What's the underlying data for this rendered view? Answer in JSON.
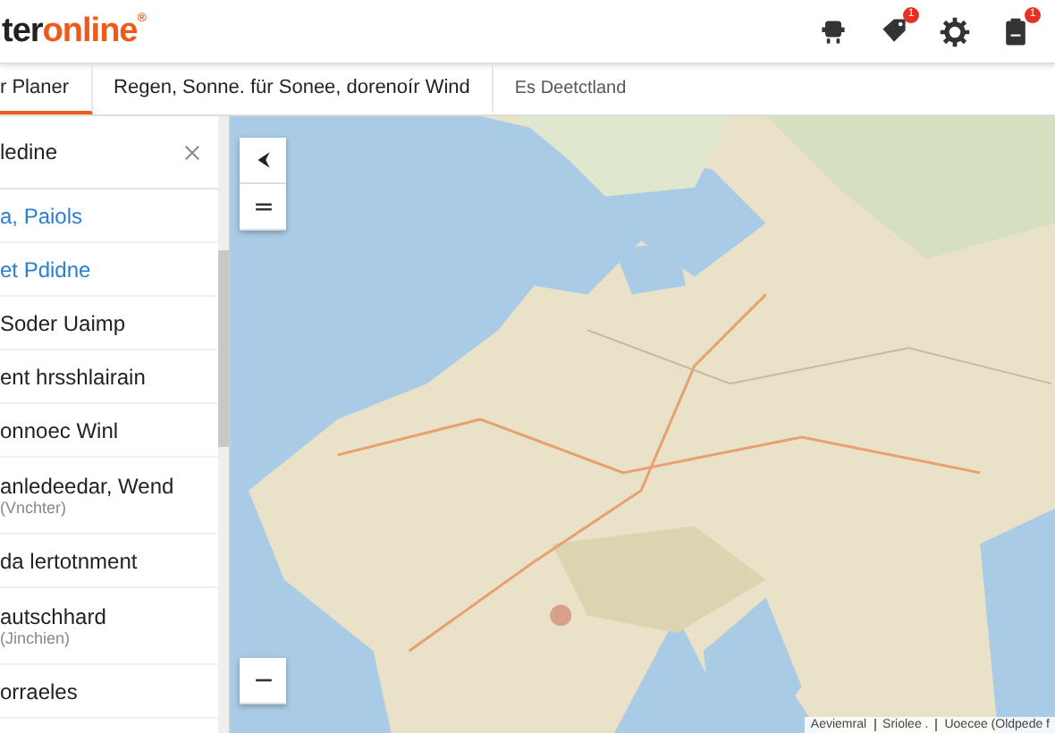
{
  "logo": {
    "dark": "ter",
    "accent": "online",
    "mark": "®"
  },
  "header_icons": [
    {
      "kind": "robot"
    },
    {
      "kind": "tag",
      "badge": "1"
    },
    {
      "kind": "gear"
    },
    {
      "kind": "clipboard",
      "badge": "1"
    }
  ],
  "nav": [
    {
      "label": "r Planer",
      "selected": true
    },
    {
      "label": "Regen, Sonne. für Sonee, dorenoír Wind",
      "selected": false
    },
    {
      "label": "Es Deetctland",
      "selected": false
    }
  ],
  "search": {
    "value": "ledine"
  },
  "results": [
    {
      "title": "a, Paiols",
      "highlighted": true
    },
    {
      "title": "et Pdidne",
      "highlighted": true
    },
    {
      "title": "Soder Uaimp",
      "highlighted": false
    },
    {
      "title": "ent hrsshlairain",
      "highlighted": false
    },
    {
      "title": "onnoec Winl",
      "highlighted": false
    },
    {
      "title": "anledeedar, Wend",
      "subtitle": "(Vnchter)",
      "highlighted": false
    },
    {
      "title": "da lertotnment",
      "highlighted": false
    },
    {
      "title": "autschhard",
      "subtitle": "(Jinchien)",
      "highlighted": false
    },
    {
      "title": "orraeles",
      "highlighted": false
    }
  ],
  "map": {
    "attribution": [
      "Aeviemral",
      "Sriolee .",
      "Uoecee (Oldpede f"
    ]
  }
}
